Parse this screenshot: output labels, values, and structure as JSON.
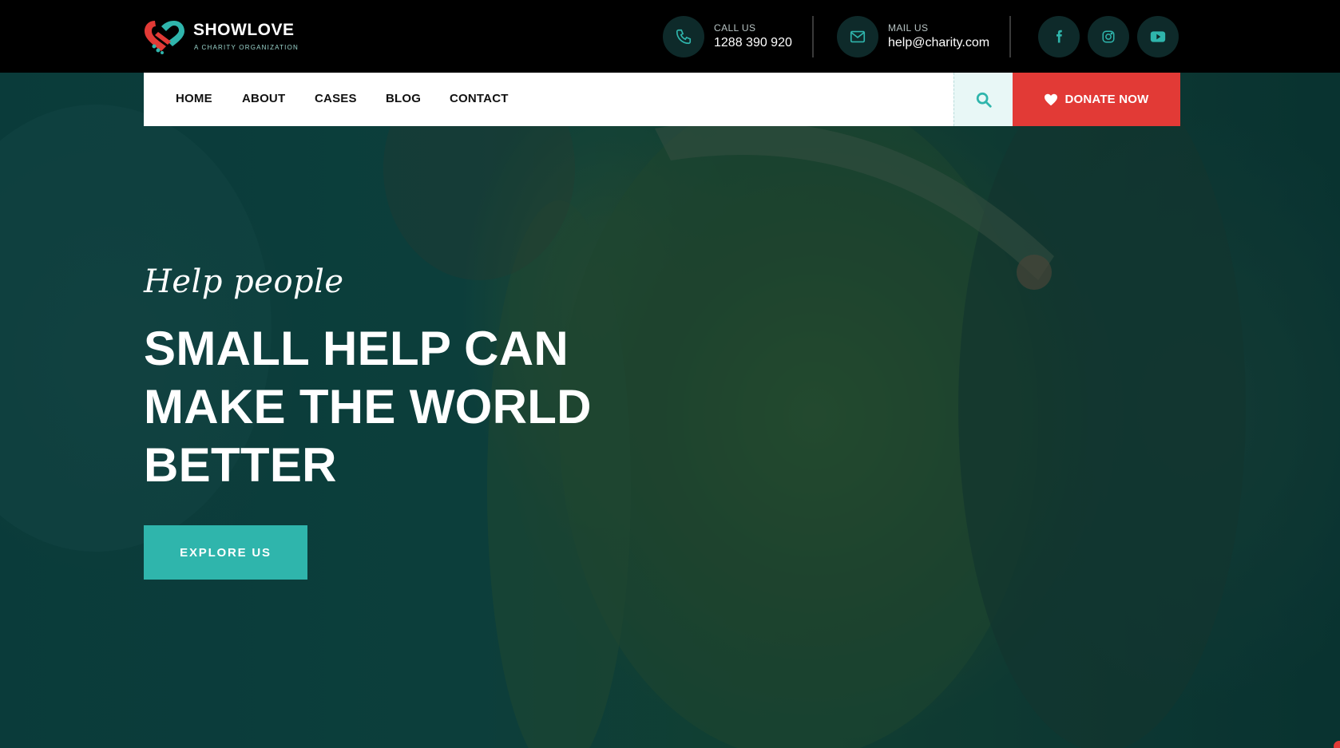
{
  "brand": {
    "name": "SHOWLOVE",
    "tagline": "A CHARITY ORGANIZATION"
  },
  "contacts": {
    "phone": {
      "label": "CALL US",
      "value": "1288 390 920",
      "icon": "phone-icon"
    },
    "mail": {
      "label": "MAIL US",
      "value": "help@charity.com",
      "icon": "envelope-icon"
    }
  },
  "social": [
    "facebook-icon",
    "instagram-icon",
    "youtube-icon"
  ],
  "nav": {
    "items": [
      "HOME",
      "ABOUT",
      "CASES",
      "BLOG",
      "CONTACT"
    ],
    "donate_label": "DONATE NOW"
  },
  "hero": {
    "script_text": "Help people",
    "headline": "SMALL HELP CAN MAKE THE WORLD BETTER",
    "button_label": "EXPLORE US"
  },
  "colors": {
    "accent_teal": "#2fb5ac",
    "accent_red": "#e23a36",
    "topbar_bg": "#000000",
    "icon_circle": "#0e2a2a"
  }
}
